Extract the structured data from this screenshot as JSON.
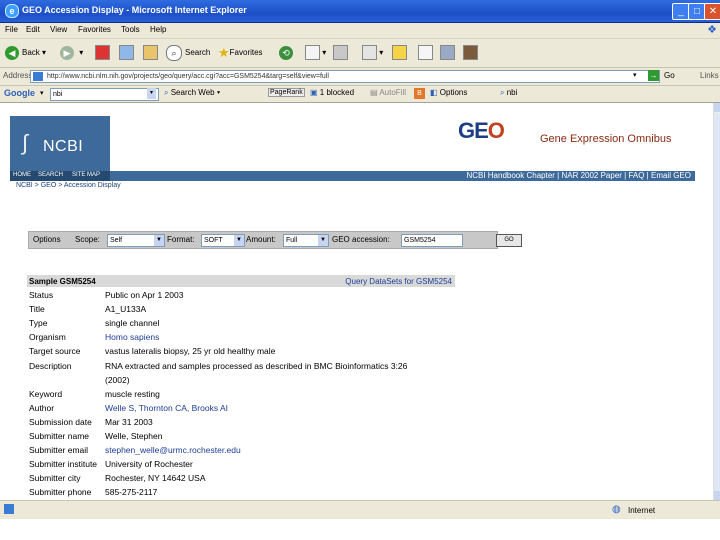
{
  "window": {
    "title": "GEO Accession Display - Microsoft Internet Explorer"
  },
  "menu": [
    "File",
    "Edit",
    "View",
    "Favorites",
    "Tools",
    "Help"
  ],
  "toolbar": {
    "back": "Back",
    "search": "Search",
    "favorites": "Favorites"
  },
  "address": {
    "label": "Address",
    "url": "http://www.ncbi.nlm.nih.gov/projects/geo/query/acc.cgi?acc=GSM5254&targ=self&view=full",
    "go": "Go",
    "links": "Links"
  },
  "googlebar": {
    "brand": "Google",
    "search_web": "Search Web",
    "pagerank": "PageRank",
    "blocked": "1 blocked",
    "autofill": "AutoFill",
    "options": "Options"
  },
  "ncbi": {
    "logo": "NCBI",
    "nav": [
      "HOME",
      "SEARCH",
      "SITE MAP"
    ]
  },
  "geo": {
    "logo_g": "GE",
    "logo_o": "O",
    "subtitle": "Gene Expression Omnibus",
    "links": "NCBI Handbook Chapter  |  NAR 2002 Paper  |  FAQ  |  Email GEO"
  },
  "breadcrumb": "NCBI > GEO > Accession Display",
  "options": {
    "label": "Options",
    "scope_label": "Scope:",
    "scope": "Self",
    "format_label": "Format:",
    "format": "SOFT",
    "amount_label": "Amount:",
    "amount": "Full",
    "accession_label": "GEO accession:",
    "accession": "GSM5254",
    "go": "GO"
  },
  "sample": {
    "title": "Sample GSM5254",
    "query": "Query DataSets for GSM5254"
  },
  "fields": [
    {
      "k": "Status",
      "v": "Public on Apr 1 2003",
      "link": false
    },
    {
      "k": "Title",
      "v": "A1_U133A",
      "link": false
    },
    {
      "k": "Type",
      "v": "single channel",
      "link": false
    },
    {
      "k": "Organism",
      "v": "Homo sapiens",
      "link": true
    },
    {
      "k": "Target source",
      "v": "vastus lateralis biopsy, 25 yr old healthy male",
      "link": false
    },
    {
      "k": "Description",
      "v": "RNA extracted and samples processed as described in BMC Bioinformatics 3:26",
      "link": false
    },
    {
      "k": "",
      "v": "(2002)",
      "link": false
    },
    {
      "k": "Keyword",
      "v": "muscle resting",
      "link": false
    },
    {
      "k": "Author",
      "v": "Welle S, Thornton CA, Brooks AI",
      "link": true
    },
    {
      "k": "Submission date",
      "v": "Mar 31 2003",
      "link": false
    },
    {
      "k": "Submitter name",
      "v": "Welle, Stephen",
      "link": false
    },
    {
      "k": "Submitter email",
      "v": "stephen_welle@urmc.rochester.edu",
      "link": true
    },
    {
      "k": "Submitter institute",
      "v": "University of Rochester",
      "link": false
    },
    {
      "k": "Submitter city",
      "v": "Rochester, NY 14642 USA",
      "link": false
    },
    {
      "k": "Submitter phone",
      "v": "585-275-2117",
      "link": false
    }
  ],
  "status": {
    "zone": "Internet"
  }
}
